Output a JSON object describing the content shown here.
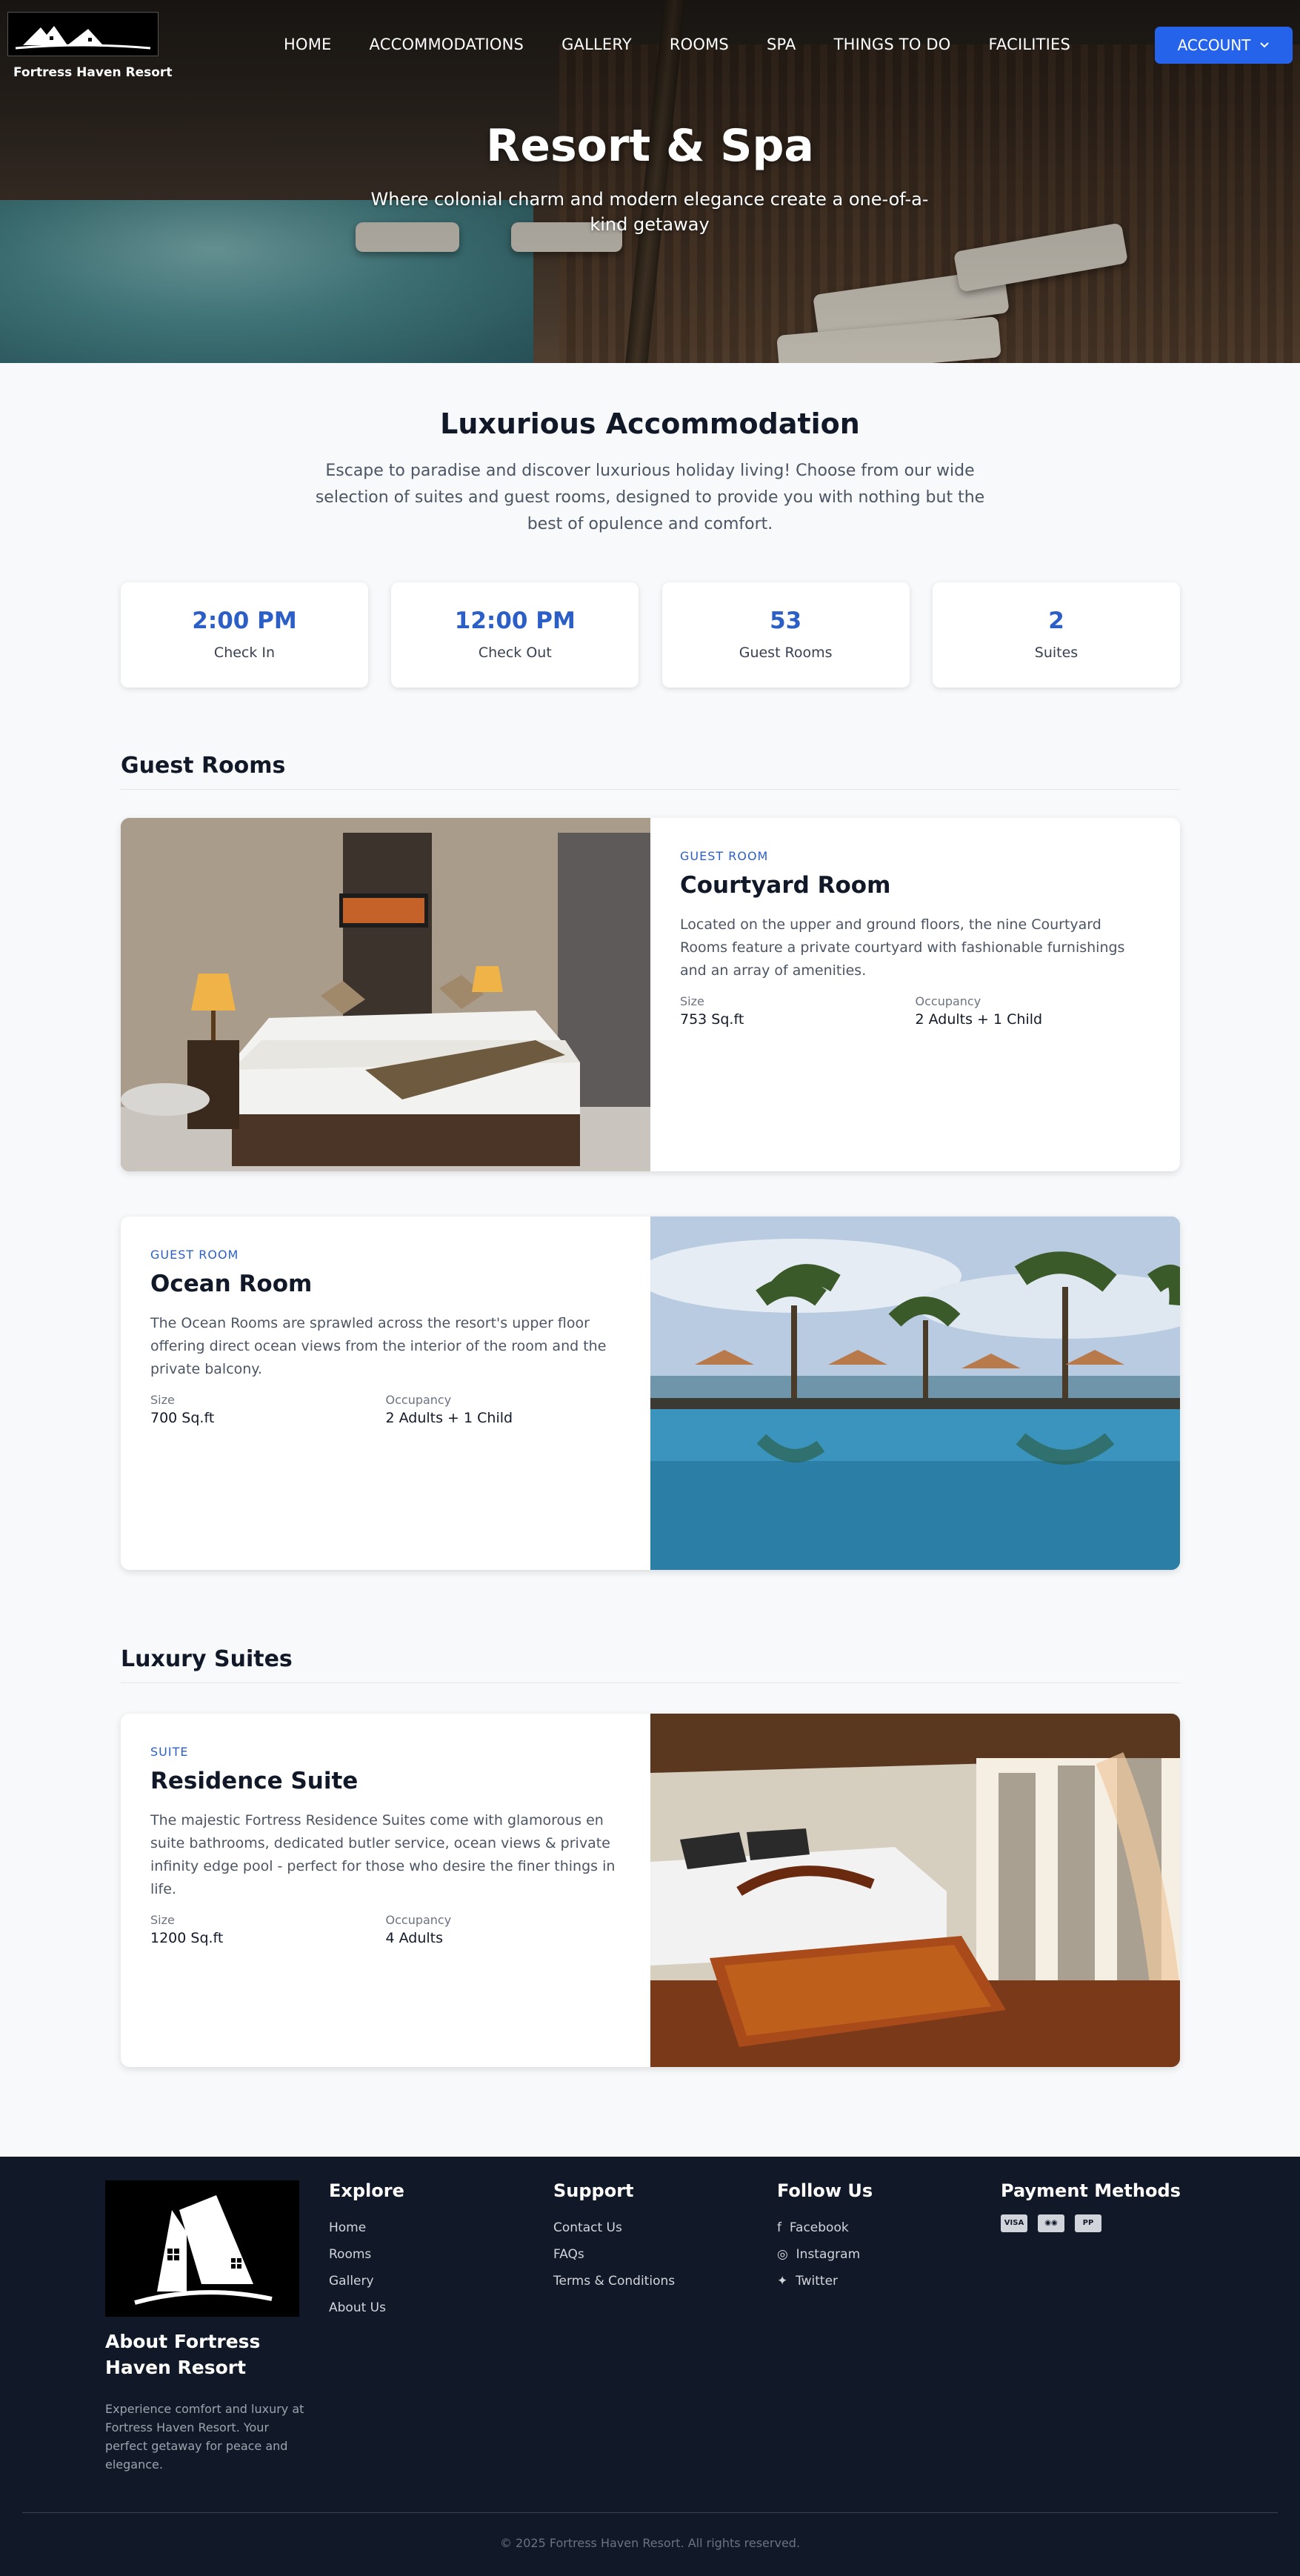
{
  "brand": {
    "name": "Fortress Haven Resort"
  },
  "nav": {
    "links": [
      "HOME",
      "ACCOMMODATIONS",
      "GALLERY",
      "ROOMS",
      "SPA",
      "THINGS TO DO",
      "FACILITIES"
    ],
    "account": "ACCOUNT"
  },
  "hero": {
    "title": "Resort & Spa",
    "subtitle": "Where colonial charm and modern elegance create a one-of-a-kind getaway"
  },
  "intro": {
    "title": "Luxurious Accommodation",
    "text": "Escape to paradise and discover luxurious holiday living! Choose from our wide selection of suites and guest rooms, designed to provide you with nothing but the best of opulence and comfort."
  },
  "stats": [
    {
      "value": "2:00 PM",
      "label": "Check In"
    },
    {
      "value": "12:00 PM",
      "label": "Check Out"
    },
    {
      "value": "53",
      "label": "Guest Rooms"
    },
    {
      "value": "2",
      "label": "Suites"
    }
  ],
  "sections": {
    "guest_rooms": "Guest Rooms",
    "suites": "Luxury Suites"
  },
  "rooms": [
    {
      "type": "GUEST ROOM",
      "name": "Courtyard Room",
      "desc": "Located on the upper and ground floors, the nine Courtyard Rooms feature a private courtyard with fashionable furnishings and an array of amenities.",
      "size_label": "Size",
      "size": "753 Sq.ft",
      "occ_label": "Occupancy",
      "occ": "2 Adults + 1 Child"
    },
    {
      "type": "GUEST ROOM",
      "name": "Ocean Room",
      "desc": "The Ocean Rooms are sprawled across the resort's upper floor offering direct ocean views from the interior of the room and the private balcony.",
      "size_label": "Size",
      "size": "700 Sq.ft",
      "occ_label": "Occupancy",
      "occ": "2 Adults + 1 Child"
    },
    {
      "type": "SUITE",
      "name": "Residence Suite",
      "desc": "The majestic Fortress Residence Suites come with glamorous en suite bathrooms, dedicated butler service, ocean views & private infinity edge pool - perfect for those who desire the finer things in life.",
      "size_label": "Size",
      "size": "1200 Sq.ft",
      "occ_label": "Occupancy",
      "occ": "4 Adults"
    }
  ],
  "footer": {
    "about_title": "About Fortress Haven Resort",
    "about_text": "Experience comfort and luxury at Fortress Haven Resort. Your perfect getaway for peace and elegance.",
    "explore": {
      "title": "Explore",
      "links": [
        "Home",
        "Rooms",
        "Gallery",
        "About Us"
      ]
    },
    "support": {
      "title": "Support",
      "links": [
        "Contact Us",
        "FAQs",
        "Terms & Conditions"
      ]
    },
    "follow": {
      "title": "Follow Us",
      "links": [
        "Facebook",
        "Instagram",
        "Twitter"
      ],
      "icons": [
        "facebook-icon",
        "instagram-icon",
        "twitter-icon"
      ]
    },
    "payment": {
      "title": "Payment Methods",
      "methods": [
        "visa-icon",
        "mastercard-icon",
        "paypal-icon"
      ]
    },
    "copyright": "© 2025 Fortress Haven Resort. All rights reserved."
  },
  "colors": {
    "accent": "#2563eb",
    "stat": "#2b5fc7",
    "footer_bg": "#111827"
  }
}
